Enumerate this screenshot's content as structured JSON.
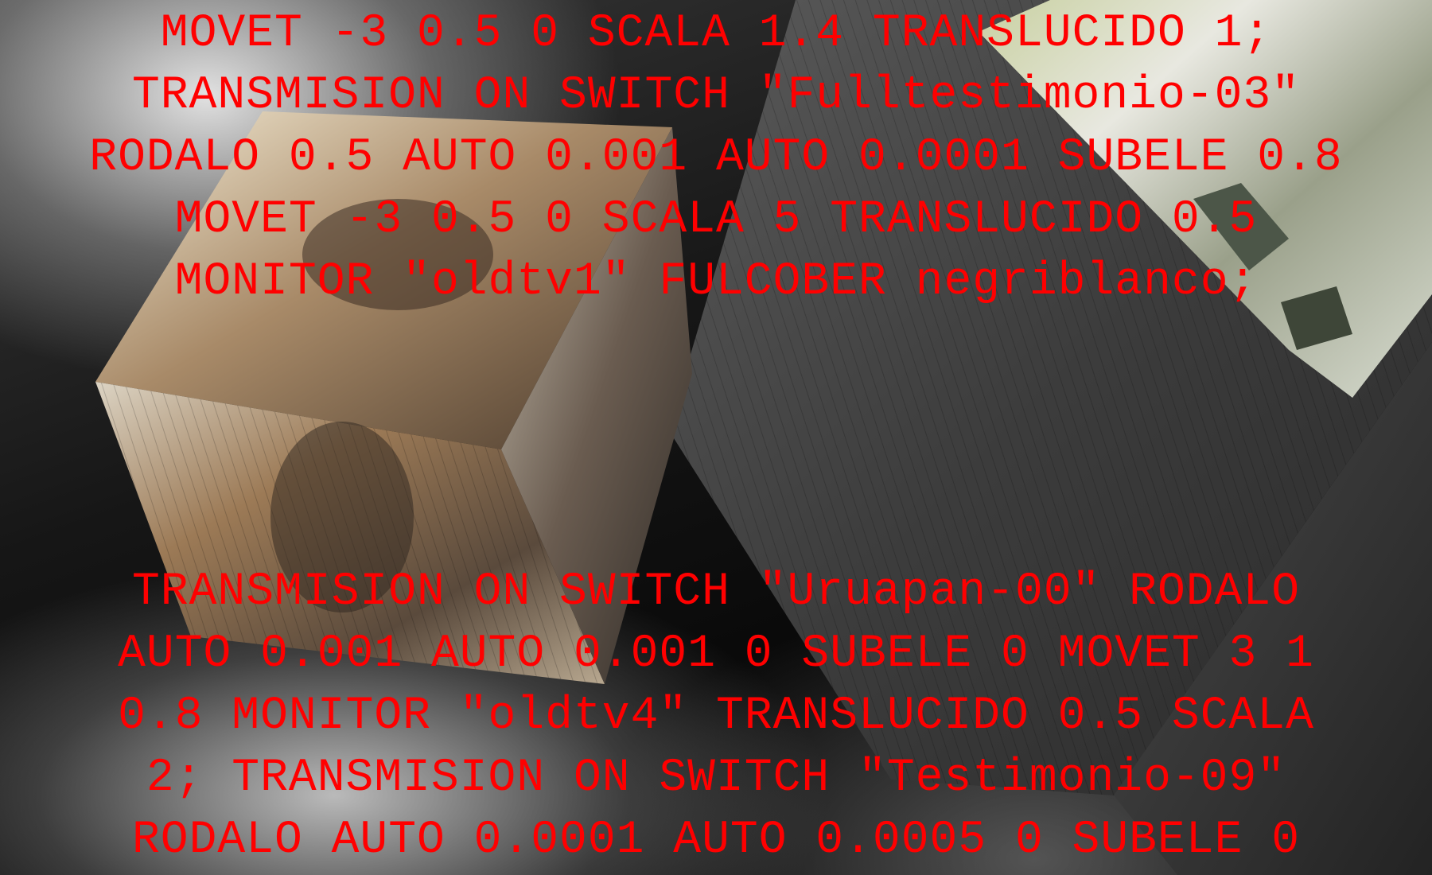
{
  "colors": {
    "code_text": "#ff0000",
    "background": "#000000"
  },
  "code_block_top": {
    "lines": [
      "MOVET -3 0.5 0 SCALA 1.4 TRANSLUCIDO 1;",
      "TRANSMISION ON SWITCH \"Fulltestimonio-03\"",
      "RODALO 0.5 AUTO 0.001 AUTO 0.0001 SUBELE 0.8",
      "MOVET -3 0.5 0 SCALA 5 TRANSLUCIDO 0.5",
      "MONITOR \"oldtv1\" FULCOBER negriblanco;"
    ]
  },
  "code_block_bottom": {
    "lines": [
      "TRANSMISION ON SWITCH \"Uruapan-00\" RODALO",
      "AUTO 0.001 AUTO 0.001 0 SUBELE 0 MOVET 3 1",
      "0.8 MONITOR \"oldtv4\" TRANSLUCIDO 0.5 SCALA",
      "2; TRANSMISION ON SWITCH \"Testimonio-09\"",
      "RODALO AUTO 0.0001 AUTO 0.0005 0 SUBELE 0"
    ]
  }
}
